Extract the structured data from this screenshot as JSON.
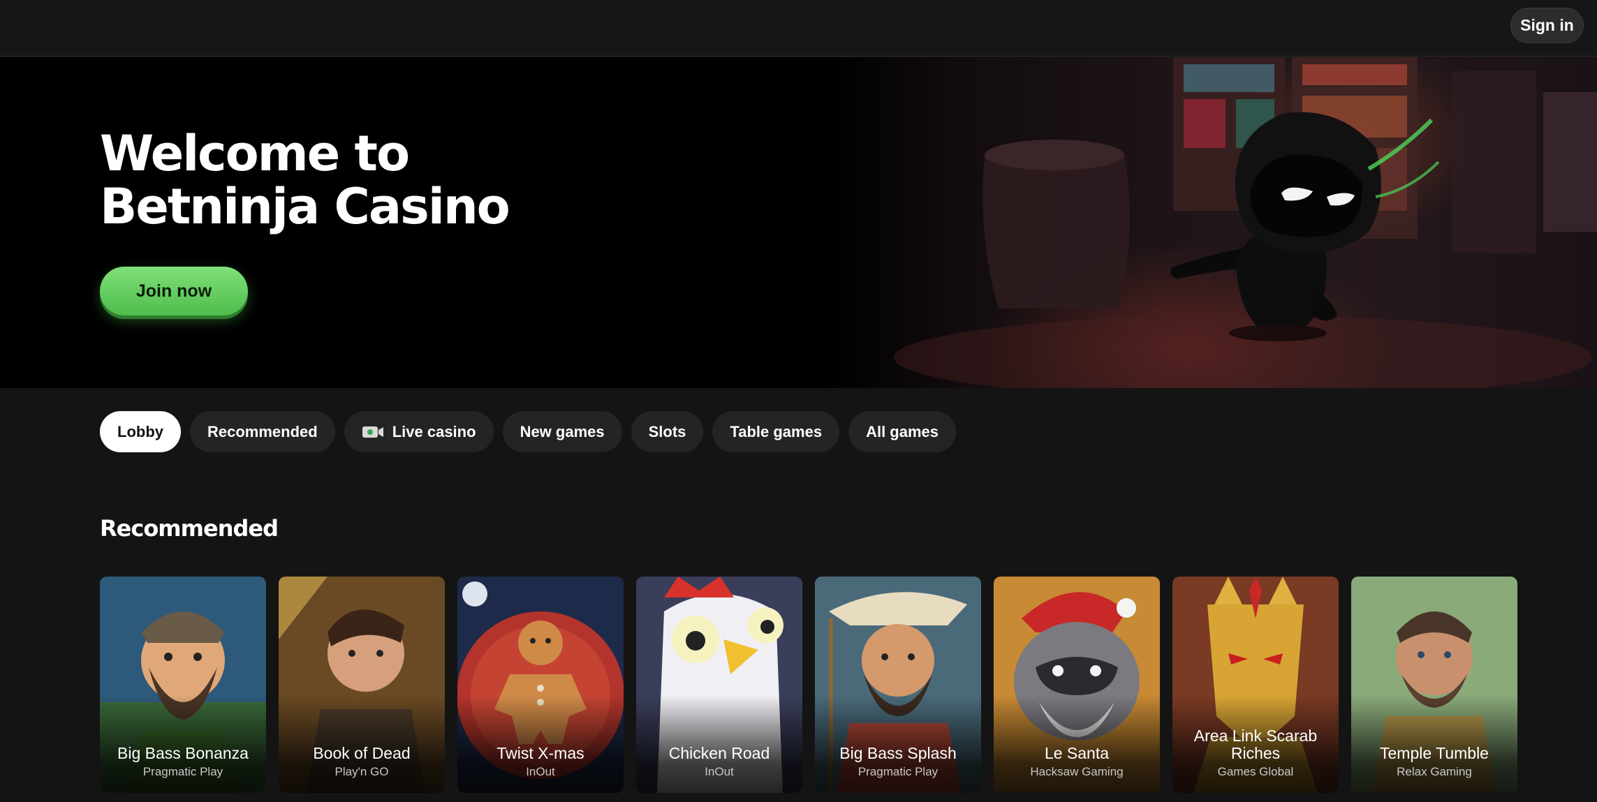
{
  "header": {
    "sign_in_label": "Sign in"
  },
  "hero": {
    "title_line1": "Welcome to",
    "title_line2": "Betninja Casino",
    "join_label": "Join now"
  },
  "tabs": [
    {
      "label": "Lobby",
      "active": true
    },
    {
      "label": "Recommended",
      "active": false
    },
    {
      "label": "Live casino",
      "active": false,
      "icon": "video-camera-icon"
    },
    {
      "label": "New games",
      "active": false
    },
    {
      "label": "Slots",
      "active": false
    },
    {
      "label": "Table games",
      "active": false
    },
    {
      "label": "All games",
      "active": false
    }
  ],
  "section": {
    "title": "Recommended"
  },
  "games": [
    {
      "name": "Big Bass Bonanza",
      "provider": "Pragmatic Play"
    },
    {
      "name": "Book of Dead",
      "provider": "Play'n GO"
    },
    {
      "name": "Twist X-mas",
      "provider": "InOut"
    },
    {
      "name": "Chicken Road",
      "provider": "InOut"
    },
    {
      "name": "Big Bass Splash",
      "provider": "Pragmatic Play"
    },
    {
      "name": "Le Santa",
      "provider": "Hacksaw Gaming"
    },
    {
      "name": "Area Link Scarab Riches",
      "provider": "Games Global"
    },
    {
      "name": "Temple Tumble",
      "provider": "Relax Gaming"
    }
  ],
  "colors": {
    "background": "#141414",
    "accent_green": "#5fcf5b",
    "tab_bg": "#242424",
    "tab_active_bg": "#ffffff"
  }
}
